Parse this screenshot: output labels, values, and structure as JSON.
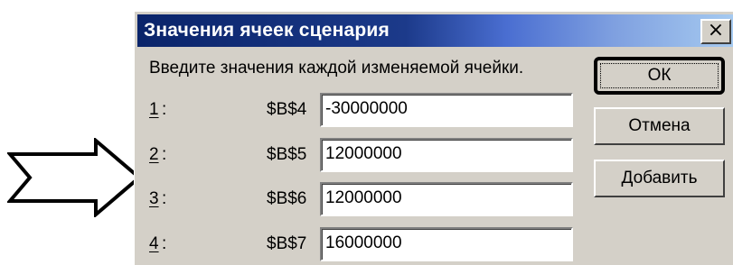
{
  "dialog": {
    "title": "Значения ячеек сценария",
    "close_label": "×",
    "prompt": "Введите значения каждой изменяемой ячейки.",
    "rows": [
      {
        "num": "1",
        "colon": ":",
        "ref": "$B$4",
        "value": "-30000000"
      },
      {
        "num": "2",
        "colon": ":",
        "ref": "$B$5",
        "value": "12000000"
      },
      {
        "num": "3",
        "colon": ":",
        "ref": "$B$6",
        "value": "12000000"
      },
      {
        "num": "4",
        "colon": ":",
        "ref": "$B$7",
        "value": "16000000"
      }
    ],
    "buttons": {
      "ok": "ОК",
      "cancel": "Отмена",
      "add": "Добавить"
    }
  },
  "colors": {
    "title_start": "#0a246a",
    "title_end": "#a6caf0",
    "dialog_face": "#d4d0c8"
  },
  "icons": {
    "close": "close-icon",
    "pointer": "right-arrow-icon"
  }
}
